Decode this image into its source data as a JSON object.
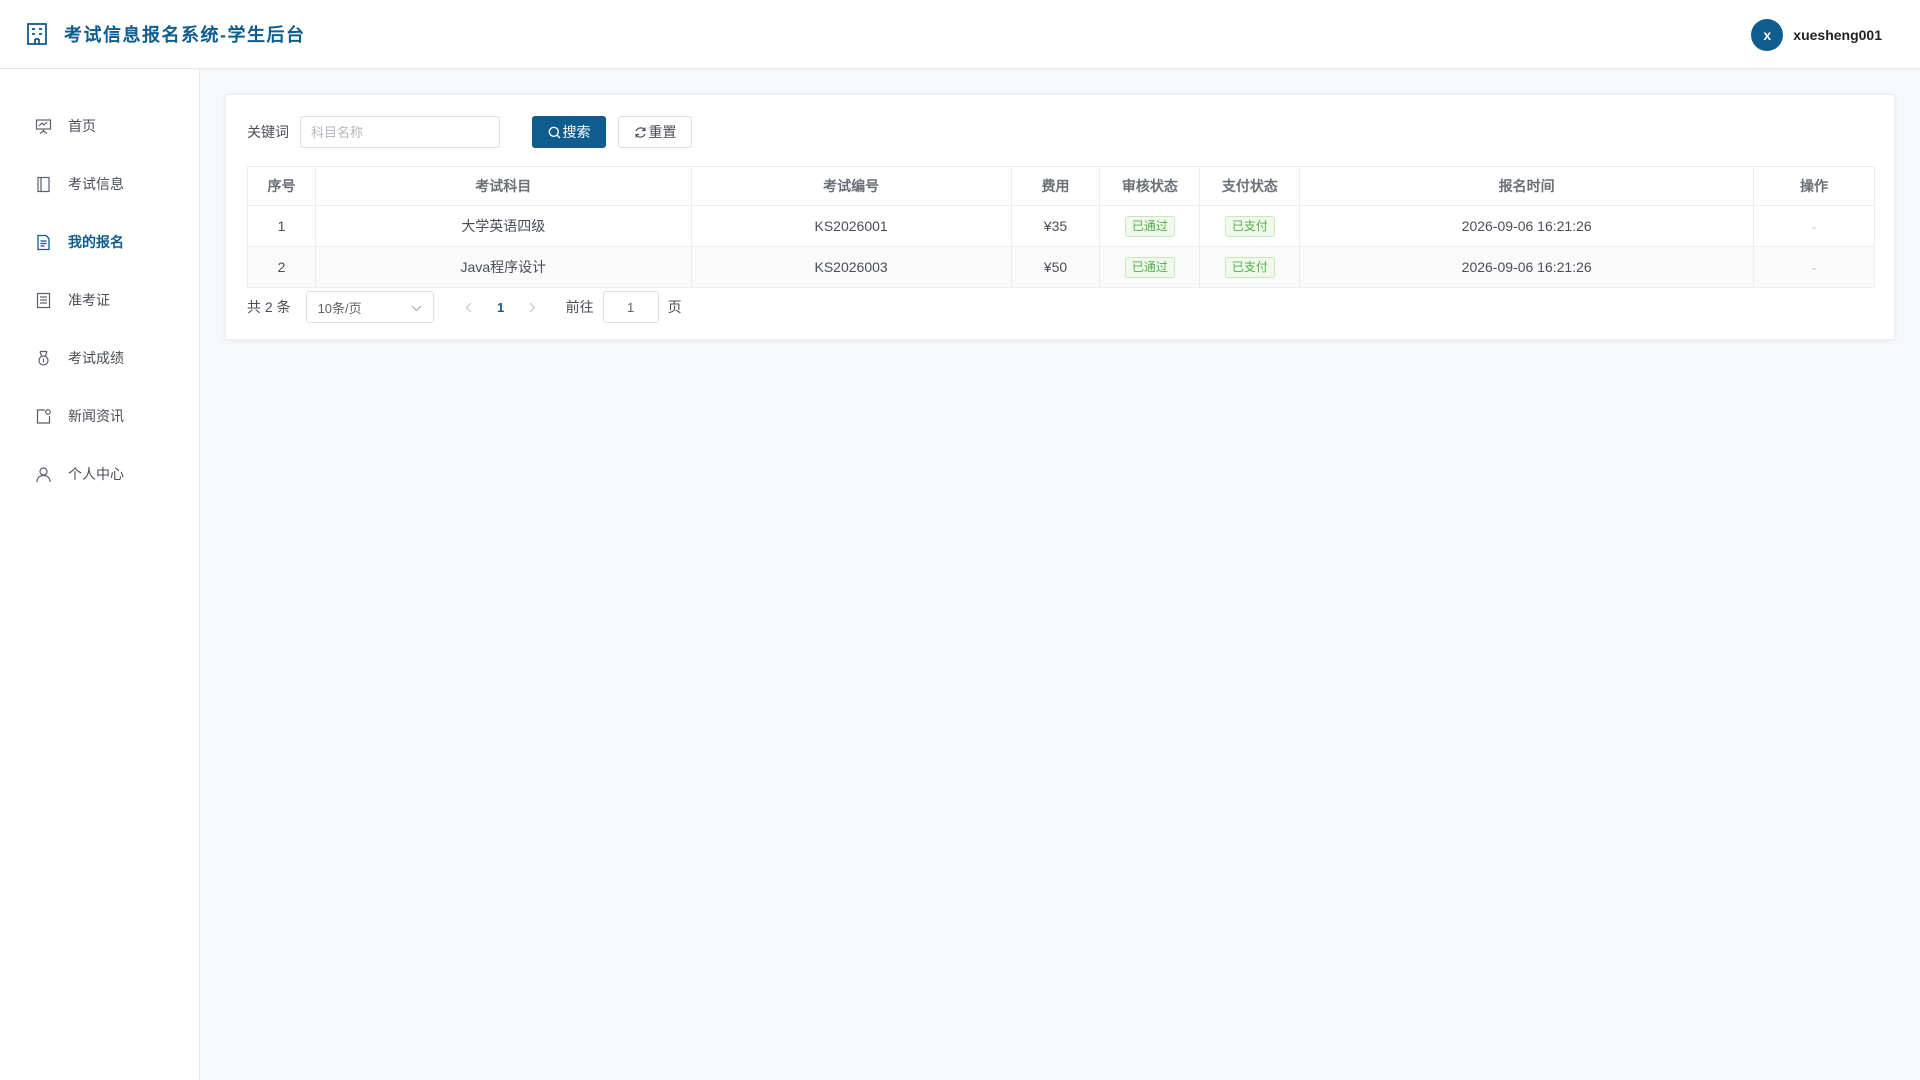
{
  "app": {
    "title": "考试信息报名系统-学生后台",
    "brand_color": "#0f5c8f"
  },
  "user": {
    "avatar_letter": "x",
    "username": "xuesheng001"
  },
  "sidebar": {
    "items": [
      {
        "label": "首页",
        "icon": "presentation-icon",
        "active": false
      },
      {
        "label": "考试信息",
        "icon": "book-icon",
        "active": false
      },
      {
        "label": "我的报名",
        "icon": "document-icon",
        "active": true
      },
      {
        "label": "准考证",
        "icon": "ticket-icon",
        "active": false
      },
      {
        "label": "考试成绩",
        "icon": "medal-icon",
        "active": false
      },
      {
        "label": "新闻资讯",
        "icon": "news-icon",
        "active": false
      },
      {
        "label": "个人中心",
        "icon": "user-icon",
        "active": false
      }
    ]
  },
  "filter": {
    "label": "关键词",
    "placeholder": "科目名称",
    "value": "",
    "search_label": "搜索",
    "reset_label": "重置"
  },
  "table": {
    "columns": [
      "序号",
      "考试科目",
      "考试编号",
      "费用",
      "审核状态",
      "支付状态",
      "报名时间",
      "操作"
    ],
    "rows": [
      {
        "index": "1",
        "subject": "大学英语四级",
        "code": "KS2026001",
        "fee": "¥35",
        "review": "已通过",
        "payment": "已支付",
        "time": "2026-09-06 16:21:26",
        "action": "-"
      },
      {
        "index": "2",
        "subject": "Java程序设计",
        "code": "KS2026003",
        "fee": "¥50",
        "review": "已通过",
        "payment": "已支付",
        "time": "2026-09-06 16:21:26",
        "action": "-"
      }
    ]
  },
  "pagination": {
    "total_text": "共 2 条",
    "page_size": "10条/页",
    "current_page": "1",
    "goto_label": "前往",
    "goto_value": "1",
    "page_suffix": "页"
  }
}
